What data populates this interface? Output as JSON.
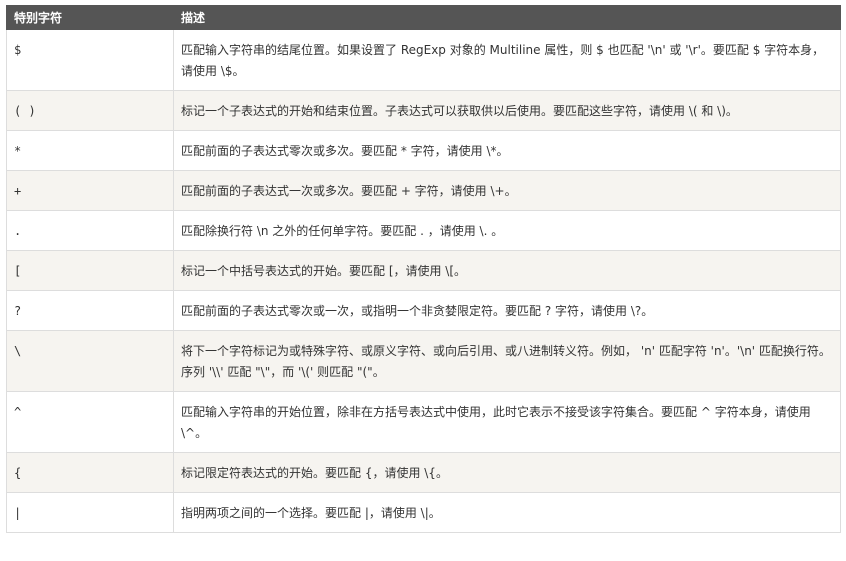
{
  "table": {
    "headers": [
      "特别字符",
      "描述"
    ],
    "rows": [
      {
        "char": "$",
        "desc": "匹配输入字符串的结尾位置。如果设置了 RegExp 对象的 Multiline 属性，则 $ 也匹配 '\\n' 或 '\\r'。要匹配 $ 字符本身，请使用 \\$。"
      },
      {
        "char": "( )",
        "desc": "标记一个子表达式的开始和结束位置。子表达式可以获取供以后使用。要匹配这些字符，请使用 \\( 和 \\)。"
      },
      {
        "char": "*",
        "desc": "匹配前面的子表达式零次或多次。要匹配 * 字符，请使用 \\*。"
      },
      {
        "char": "+",
        "desc": "匹配前面的子表达式一次或多次。要匹配 + 字符，请使用 \\+。"
      },
      {
        "char": ".",
        "desc": "匹配除换行符 \\n 之外的任何单字符。要匹配 . ，请使用 \\. 。"
      },
      {
        "char": "[",
        "desc": "标记一个中括号表达式的开始。要匹配 [，请使用 \\[。"
      },
      {
        "char": "?",
        "desc": "匹配前面的子表达式零次或一次，或指明一个非贪婪限定符。要匹配 ? 字符，请使用 \\?。"
      },
      {
        "char": "\\",
        "desc": "将下一个字符标记为或特殊字符、或原义字符、或向后引用、或八进制转义符。例如， 'n' 匹配字符 'n'。'\\n' 匹配换行符。序列 '\\\\' 匹配 \"\\\"，而 '\\(' 则匹配 \"(\"。"
      },
      {
        "char": "^",
        "desc": "匹配输入字符串的开始位置，除非在方括号表达式中使用，此时它表示不接受该字符集合。要匹配 ^ 字符本身，请使用 \\^。"
      },
      {
        "char": "{",
        "desc": "标记限定符表达式的开始。要匹配 {，请使用 \\{。"
      },
      {
        "char": "|",
        "desc": "指明两项之间的一个选择。要匹配 |，请使用 \\|。"
      }
    ]
  },
  "colors": {
    "header_bg": "#555555",
    "header_text": "#ffffff",
    "row_alt_bg": "#f6f4f0",
    "border": "#dddddd"
  }
}
